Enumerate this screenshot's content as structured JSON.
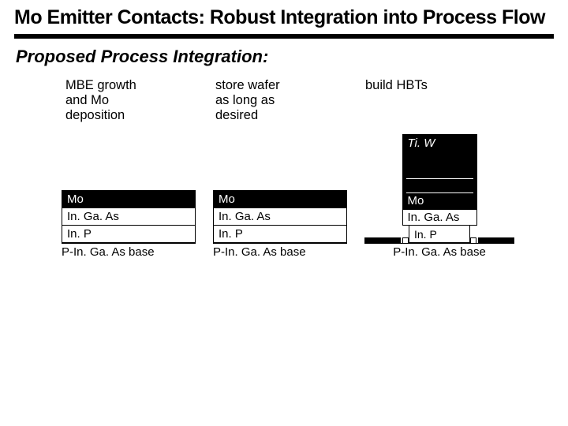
{
  "title": "Mo Emitter Contacts: Robust Integration into Process Flow",
  "subtitle": "Proposed Process Integration:",
  "stages": [
    {
      "label": "MBE growth\nand Mo\ndeposition"
    },
    {
      "label": "store wafer\nas long as\ndesired"
    },
    {
      "label": "build HBTs"
    }
  ],
  "stack_layers": {
    "mo": "Mo",
    "ingaas": "In. Ga. As",
    "inp": "In. P",
    "base": "P-In. Ga. As base"
  },
  "hbt": {
    "tiw": "Ti. W",
    "mo": "Mo",
    "ingaas": "In. Ga. As",
    "inp": "In. P",
    "base": "P-In. Ga. As base"
  }
}
